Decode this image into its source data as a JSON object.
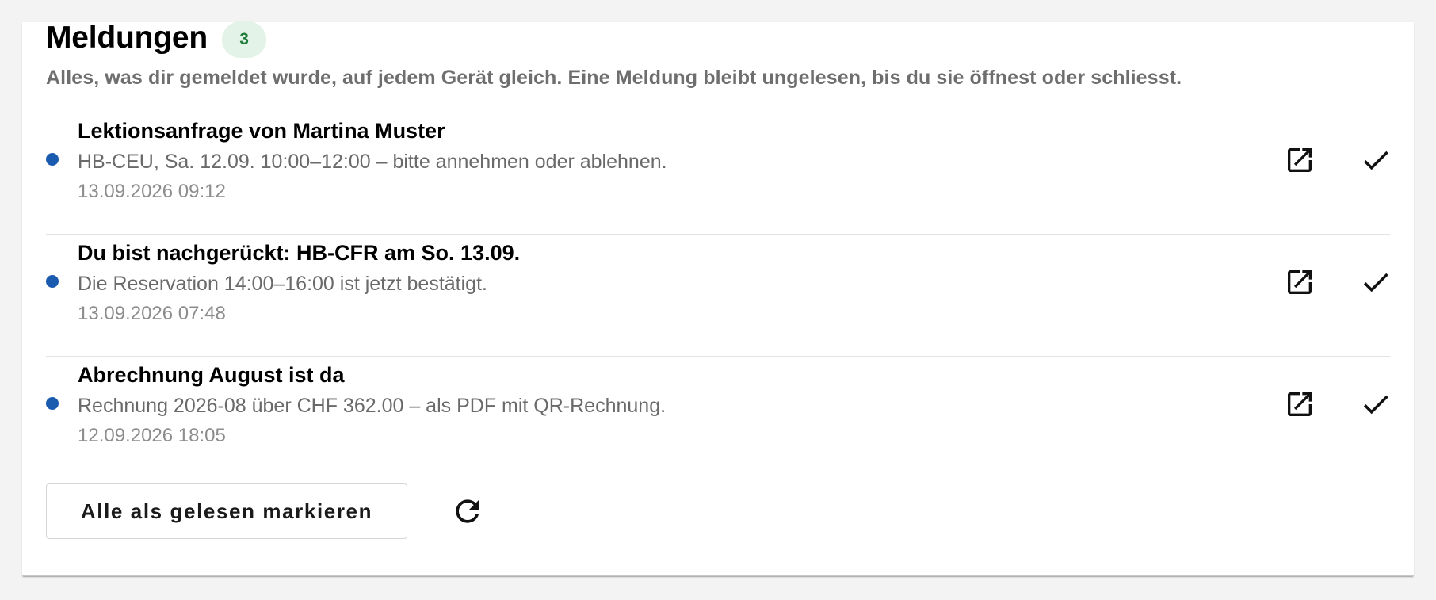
{
  "notifications": {
    "title": "Meldungen",
    "unread_count": "3",
    "subtitle": "Alles, was dir gemeldet wurde, auf jedem Gerät gleich. Eine Meldung bleibt ungelesen, bis du sie öffnest oder schliesst.",
    "items": [
      {
        "title": "Lektionsanfrage von Martina Muster",
        "body": "HB-CEU, Sa. 12.09. 10:00–12:00 – bitte annehmen oder ablehnen.",
        "time": "13.09.2026 09:12",
        "unread": true
      },
      {
        "title": "Du bist nachgerückt: HB-CFR am So. 13.09.",
        "body": "Die Reservation 14:00–16:00 ist jetzt bestätigt.",
        "time": "13.09.2026 07:48",
        "unread": true
      },
      {
        "title": "Abrechnung August ist da",
        "body": "Rechnung 2026-08 über CHF 362.00 – als PDF mit QR-Rechnung.",
        "time": "12.09.2026 18:05",
        "unread": true
      }
    ],
    "mark_all_label": "Alle als gelesen markieren"
  },
  "icons": {
    "open": "open-in-new-icon",
    "read": "check-icon",
    "refresh": "refresh-icon",
    "unread_dot": "unread-dot"
  },
  "colors": {
    "unread_dot": "#1a5bb0",
    "badge_bg": "#e4f3e7",
    "badge_text": "#1e7d3a"
  }
}
